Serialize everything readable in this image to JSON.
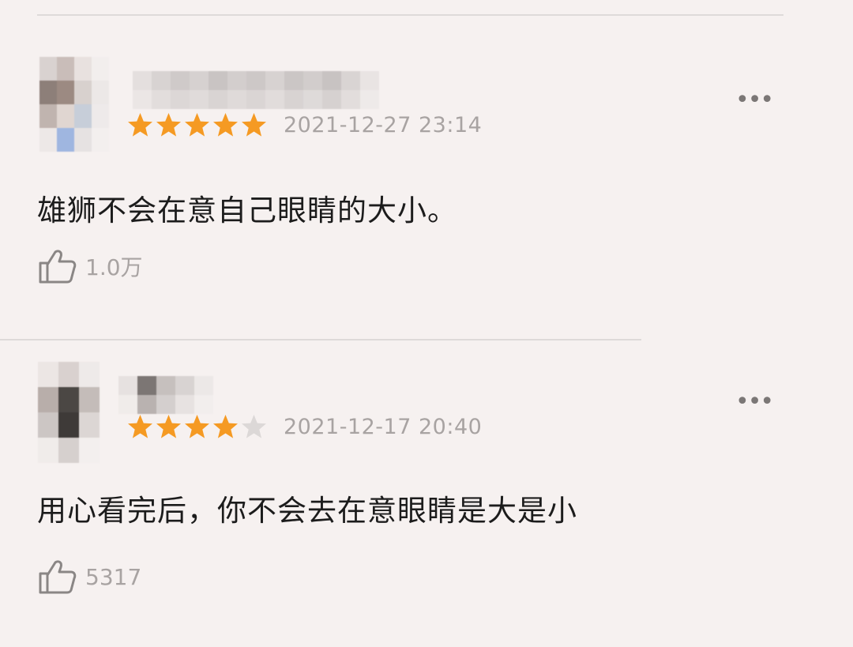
{
  "comments": [
    {
      "rating": 5,
      "date": "2021-12-27 23:14",
      "text": "雄狮不会在意自己眼睛的大小。",
      "likes": "1.0万",
      "more_icon": "more-dots-icon",
      "like_icon": "thumbs-up-icon"
    },
    {
      "rating": 4,
      "date": "2021-12-17 20:40",
      "text": "用心看完后，你不会去在意眼睛是大是小",
      "likes": "5317",
      "more_icon": "more-dots-icon",
      "like_icon": "thumbs-up-icon"
    }
  ],
  "colors": {
    "background": "#f6f1f0",
    "star_filled": "#f59a23",
    "star_empty": "#dcd8d7",
    "secondary_text": "#a8a3a2",
    "divider": "#dedad9"
  }
}
